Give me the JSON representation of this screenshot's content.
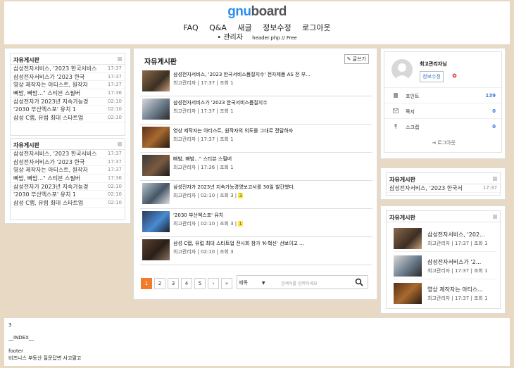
{
  "header": {
    "logo_g": "gnu",
    "logo_b": "board",
    "nav": [
      "FAQ",
      "Q&A",
      "새글",
      "정보수정",
      "로그아웃"
    ],
    "nav2_bullet": "•",
    "nav2_admin": "관리자",
    "nav2_info": "header.php // Free"
  },
  "left_boxes": [
    {
      "title": "자유게시판",
      "items": [
        {
          "title": "삼성전자서비스, '2023 한국서비스",
          "date": "17:37"
        },
        {
          "title": "삼성전자서비스가 '2023 한국",
          "date": "17:37"
        },
        {
          "title": "영상 제작자는 아티스트, 원작자",
          "date": "17:37"
        },
        {
          "title": "빠밤, 빠밤...\" 스티븐 스필버",
          "date": "17:36"
        },
        {
          "title": "삼성전자가 2023년 지속가능경",
          "date": "02:10"
        },
        {
          "title": "'2030 부산엑스포' 유치 1",
          "date": "02:10"
        },
        {
          "title": "삼성 C랩, 유럽 최대 스타트업",
          "date": "02:10"
        }
      ]
    },
    {
      "title": "자유게시판",
      "items": [
        {
          "title": "삼성전자서비스, '2023 한국서비스",
          "date": "17:37"
        },
        {
          "title": "삼성전자서비스가 '2023 한국",
          "date": "17:37"
        },
        {
          "title": "영상 제작자는 아티스트, 원작자",
          "date": "17:37"
        },
        {
          "title": "빠밤, 빠밤...\" 스티븐 스필버",
          "date": "17:36"
        },
        {
          "title": "삼성전자가 2023년 지속가능경",
          "date": "02:10"
        },
        {
          "title": "'2030 부산엑스포' 유치 1",
          "date": "02:10"
        },
        {
          "title": "삼성 C랩, 유럽 최대 스타트업",
          "date": "02:10"
        }
      ]
    }
  ],
  "center": {
    "title": "자유게시판",
    "write_label": "글쓰기",
    "posts": [
      {
        "title": "삼성전자서비스, '2023 한국서비스품질지수' 전자제품 AS 전 부...",
        "meta": "최고관리자 | 17:37 | 조회 1",
        "badge": ""
      },
      {
        "title": "삼성전자서비스가 '2023 한국서비스품질지수",
        "meta": "최고관리자 | 17:37 | 조회 1",
        "badge": ""
      },
      {
        "title": "영상 제작자는 아티스트, 원작자의 의도를 그대로 전달하자",
        "meta": "최고관리자 | 17:37 | 조회 1",
        "badge": ""
      },
      {
        "title": "빠밤, 빠밤...\" 스티븐 스필버",
        "meta": "최고관리자 | 17:36 | 조회 1",
        "badge": ""
      },
      {
        "title": "삼성전자가 2023년 지속가능경영보고서를 30일 발간했다.",
        "meta": "최고관리자 | 02:10 | 조회 3 |",
        "badge": "3"
      },
      {
        "title": "'2030 부산엑스포' 유치",
        "meta": "최고관리자 | 02:10 | 조회 3 |",
        "badge": "1"
      },
      {
        "title": "삼성 C랩, 유럽 최대 스타트업 전시회 참가 'K-혁신' 선보이고 ...",
        "meta": "최고관리자 | 02:10 | 조회 3",
        "badge": ""
      }
    ],
    "pages": [
      "1",
      "2",
      "3",
      "4",
      "5",
      "›",
      "»"
    ],
    "search_select": "제목",
    "search_placeholder": "검색어를 입력하세요"
  },
  "profile": {
    "name": "최고관리자님",
    "info_button": "정보수정",
    "rows": [
      {
        "label": "포인트",
        "value": "139"
      },
      {
        "label": "쪽지",
        "value": "0"
      },
      {
        "label": "스크랩",
        "value": "0"
      }
    ],
    "logout": "로그아웃"
  },
  "right_box1": {
    "title": "자유게시판",
    "items": [
      {
        "title": "삼성전자서비스, '2023 한국서",
        "date": "17:37"
      }
    ]
  },
  "right_box2": {
    "title": "자유게시판",
    "items": [
      {
        "title": "삼성전자서비스, '202...",
        "meta": "최고관리자 | 17:37 | 조회 1"
      },
      {
        "title": "삼성전자서비스가 '2...",
        "meta": "최고관리자 | 17:37 | 조회 1"
      },
      {
        "title": "영상 제작자는 아티스...",
        "meta": "최고관리자 | 17:37 | 조회 1"
      }
    ]
  },
  "footer": {
    "line1": "3",
    "line2": "__INDEX__",
    "line3": "footer",
    "line4": "비즈니스 부동산 질문답변 사고팔고"
  },
  "colors": {
    "accent": "#f17c2c",
    "link_blue": "#3a78d6",
    "highlight": "#ffeb3b",
    "background": "#e8d9c4"
  }
}
